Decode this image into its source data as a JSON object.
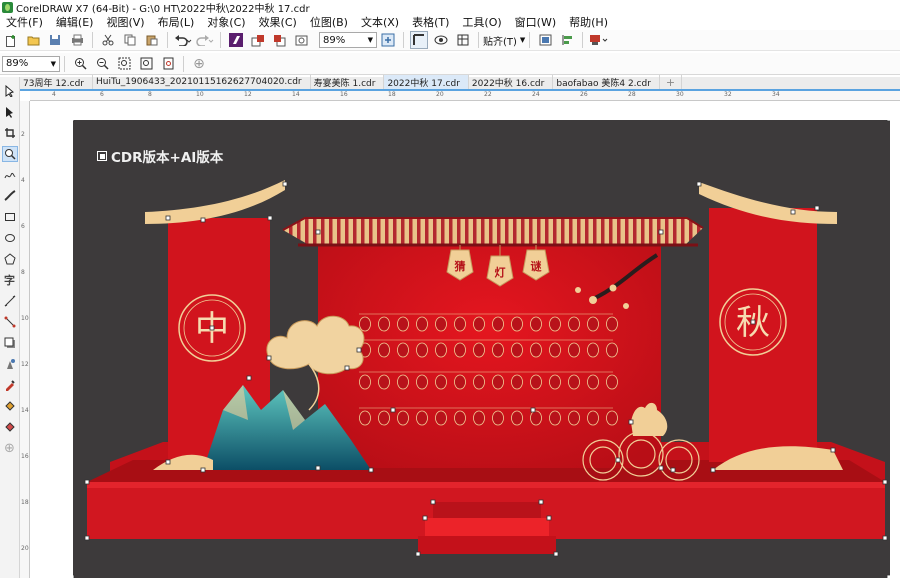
{
  "window": {
    "title": "CorelDRAW X7 (64-Bit) - G:\\0 HT\\2022中秋\\2022中秋 17.cdr"
  },
  "menu": [
    "文件(F)",
    "编辑(E)",
    "视图(V)",
    "布局(L)",
    "对象(C)",
    "效果(C)",
    "位图(B)",
    "文本(X)",
    "表格(T)",
    "工具(O)",
    "窗口(W)",
    "帮助(H)"
  ],
  "toolbar": {
    "zoom_value": "89%",
    "snap_label": "贴齐(T)"
  },
  "propertybar": {
    "zoom_value": "89%"
  },
  "tabs": [
    {
      "label": "73周年 12.cdr",
      "active": false
    },
    {
      "label": "HuiTu_1906433_20210115162627704020.cdr",
      "active": false
    },
    {
      "label": "寿宴美陈 1.cdr",
      "active": false
    },
    {
      "label": "2022中秋 17.cdr",
      "active": true
    },
    {
      "label": "2022中秋 16.cdr",
      "active": false
    },
    {
      "label": "baofabao 美陈4 2.cdr",
      "active": false
    }
  ],
  "ruler_h": [
    "4",
    "6",
    "8",
    "10",
    "12",
    "14",
    "16",
    "18",
    "20",
    "22",
    "24",
    "26",
    "28",
    "30",
    "32",
    "34"
  ],
  "ruler_v": [
    "2",
    "4",
    "6",
    "8",
    "10",
    "12",
    "14",
    "16",
    "18",
    "20"
  ],
  "canvas": {
    "version_label": "CDR版本+AI版本",
    "left_char": "中",
    "right_char": "秋",
    "lantern_chars": [
      "猜",
      "灯",
      "谜"
    ],
    "page_bg": "#3d3a3b",
    "red": "#d3121a",
    "dark_red": "#a80e14",
    "gold": "#f1cf97",
    "teal": "#1e8f8f"
  }
}
